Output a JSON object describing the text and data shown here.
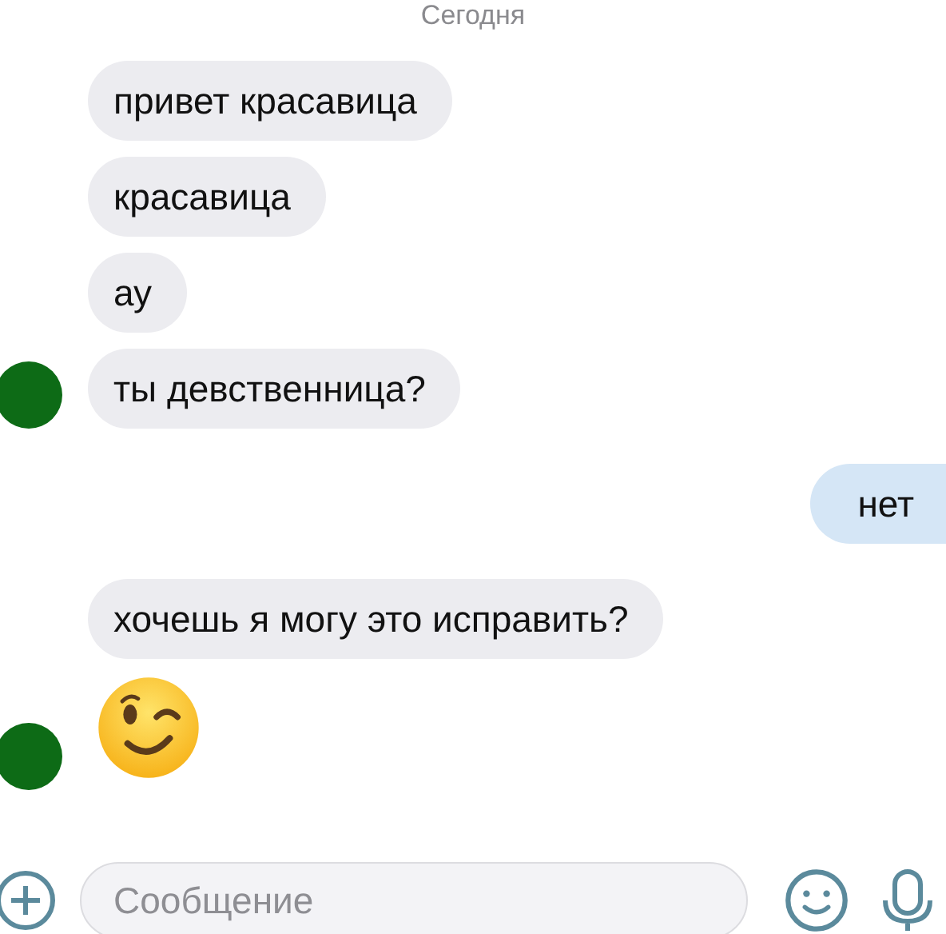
{
  "date_label": "Сегодня",
  "messages": [
    {
      "kind": "text",
      "text": "привет красавица",
      "outgoing": false,
      "avatar": false
    },
    {
      "kind": "text",
      "text": "красавица",
      "outgoing": false,
      "avatar": false
    },
    {
      "kind": "text",
      "text": "ау",
      "outgoing": false,
      "avatar": false
    },
    {
      "kind": "text",
      "text": "ты девственница?",
      "outgoing": false,
      "avatar": true
    },
    {
      "kind": "text",
      "text": "нет",
      "outgoing": true
    },
    {
      "kind": "text",
      "text": "хочешь я могу это исправить?",
      "outgoing": false,
      "avatar": false
    },
    {
      "kind": "emoji",
      "outgoing": false,
      "avatar": true
    }
  ],
  "composer": {
    "placeholder": "Сообщение"
  }
}
